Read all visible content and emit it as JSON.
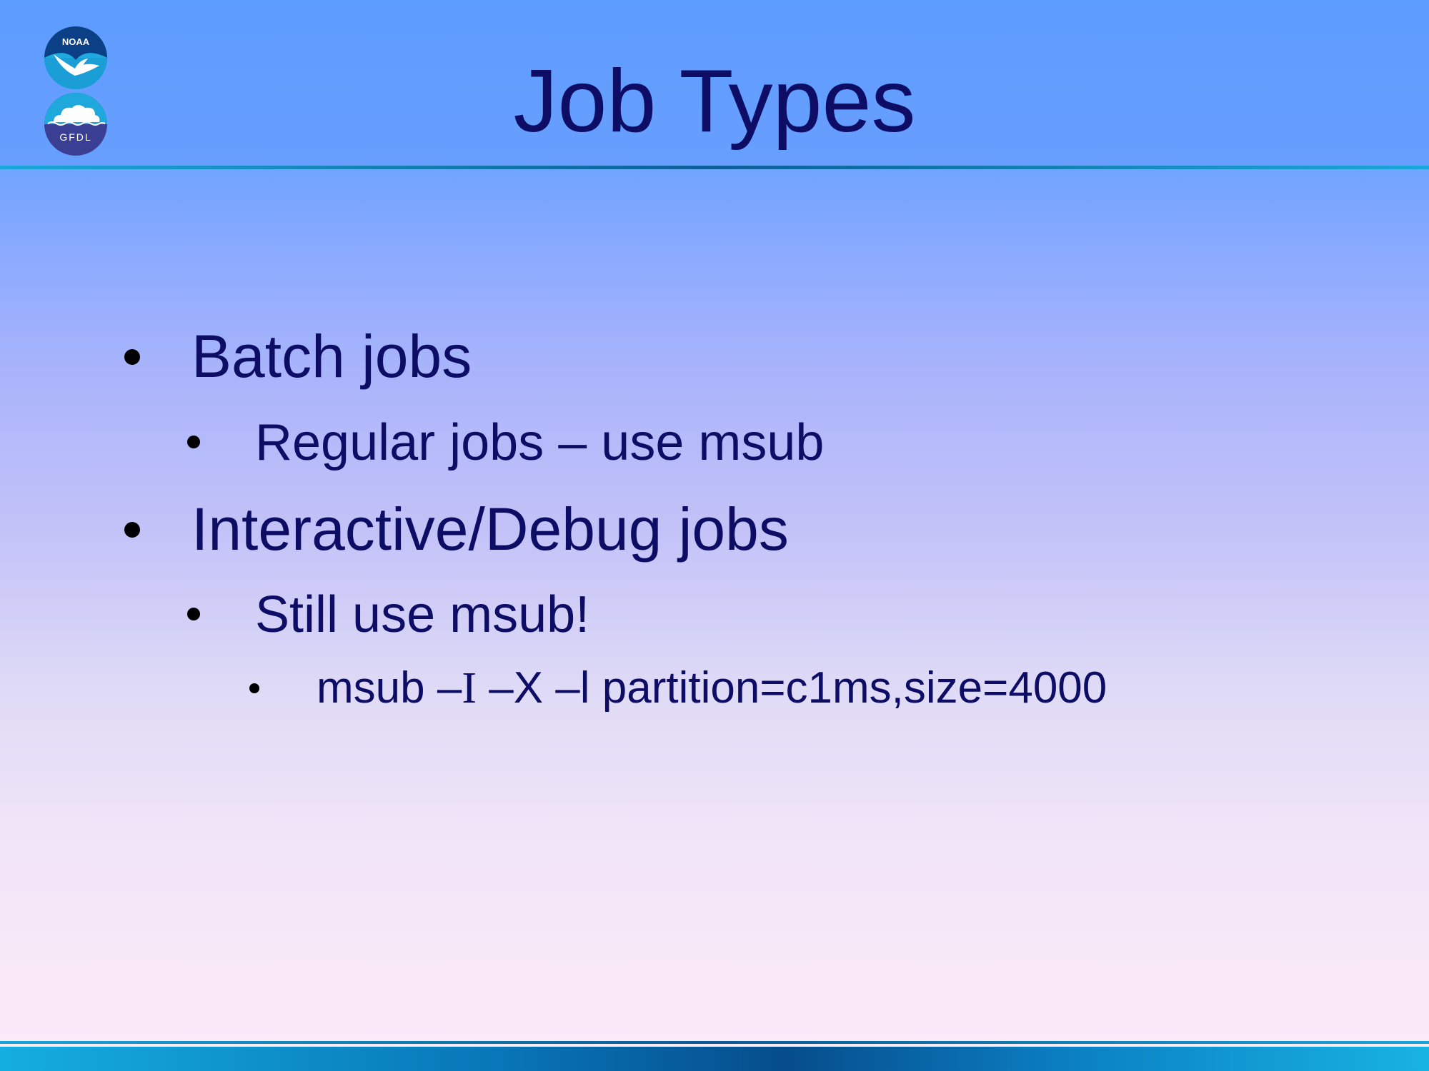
{
  "slide": {
    "title": "Job Types",
    "logos": {
      "noaa_text": "NOAA",
      "gfdl_text": "GFDL"
    },
    "bullets": [
      {
        "level": 1,
        "text": "Batch jobs"
      },
      {
        "level": 2,
        "text": "Regular jobs – use msub"
      },
      {
        "level": 1,
        "text": "Interactive/Debug jobs"
      },
      {
        "level": 2,
        "text": "Still use msub!"
      },
      {
        "level": 3,
        "text_part1": "msub –",
        "text_part2": "I",
        "text_part3": " –X –l partition=c1ms,size=4000"
      }
    ]
  },
  "colors": {
    "text": "#0d0d66",
    "band_top": "#5d9cff",
    "accent_rule": "#0c5e99"
  }
}
